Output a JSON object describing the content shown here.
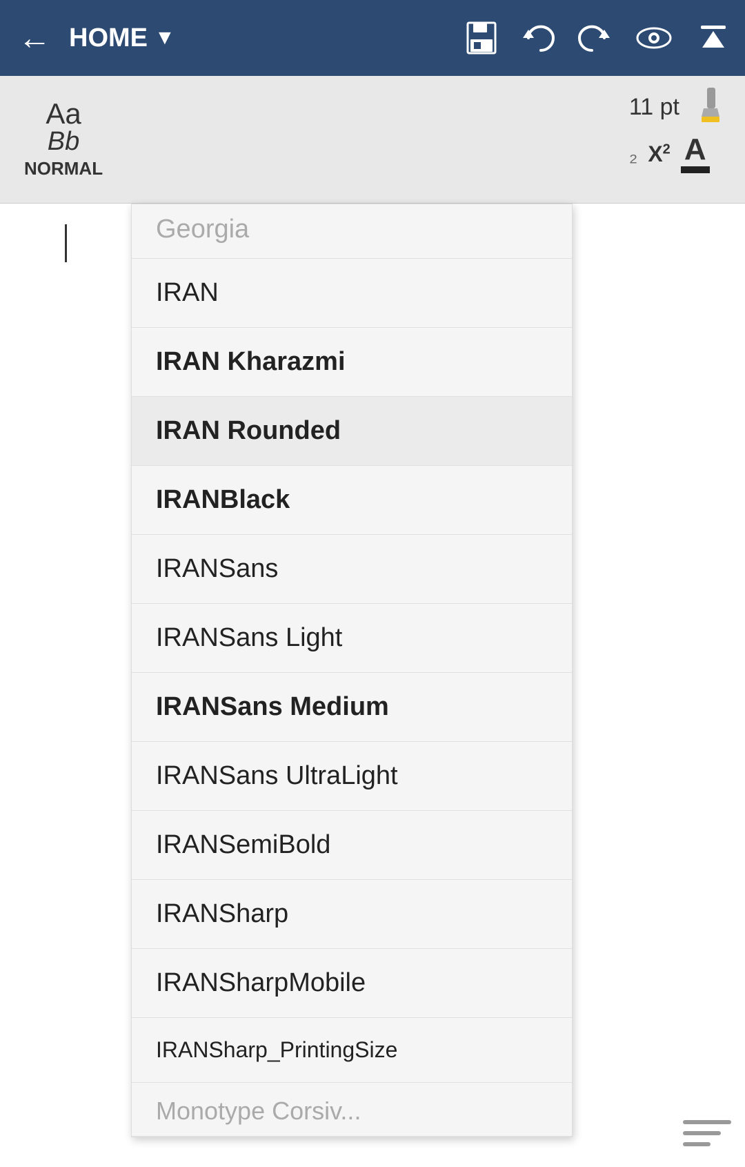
{
  "nav": {
    "back_label": "←",
    "home_label": "HOME",
    "chevron": "▼",
    "icons": {
      "save": "💾",
      "undo": "↺",
      "redo": "↻",
      "eye": "◉",
      "up": "∧"
    }
  },
  "toolbar": {
    "font_style_aa": "Aa",
    "font_style_bb": "Bb",
    "font_style_normal": "NORMAL",
    "font_size": "11 pt",
    "superscript_label": "X²",
    "font_color_label": "A"
  },
  "font_dropdown": {
    "items": [
      {
        "label": "Georgia",
        "style": "partial",
        "visible_top": true
      },
      {
        "label": "IRAN",
        "style": "normal"
      },
      {
        "label": "IRAN Kharazmi",
        "style": "bold"
      },
      {
        "label": "IRAN Rounded",
        "style": "bold",
        "selected": true
      },
      {
        "label": "IRANBlack",
        "style": "bold"
      },
      {
        "label": "IRANSans",
        "style": "normal"
      },
      {
        "label": "IRANSans Light",
        "style": "normal"
      },
      {
        "label": "IRANSans Medium",
        "style": "bold"
      },
      {
        "label": "IRANSans UltraLight",
        "style": "normal"
      },
      {
        "label": "IRANSemiBold",
        "style": "normal"
      },
      {
        "label": "IRANSharp",
        "style": "normal"
      },
      {
        "label": "IRANSharpMobile",
        "style": "normal"
      },
      {
        "label": "IRANSharp_PrintingSize",
        "style": "small"
      },
      {
        "label": "Monotype Corsiva",
        "style": "partial_bottom",
        "visible_bottom": true
      }
    ]
  }
}
